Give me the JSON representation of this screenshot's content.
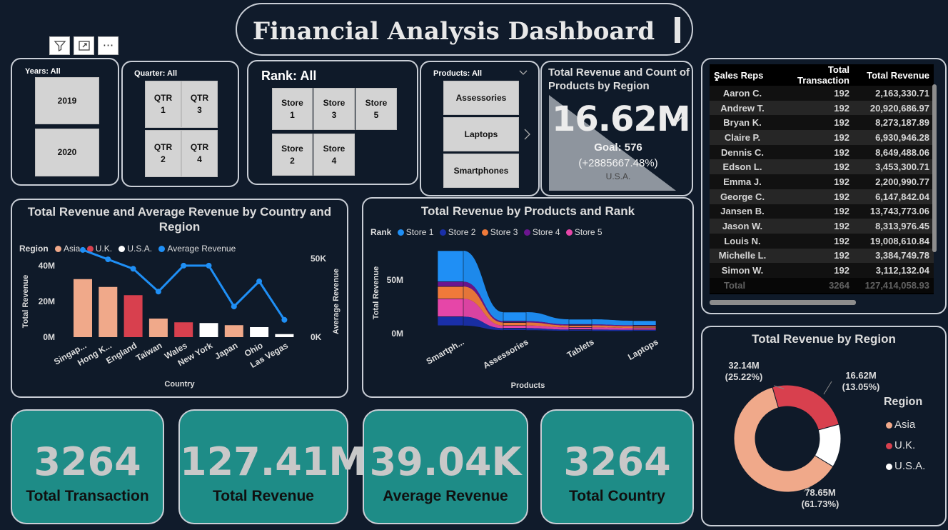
{
  "header": {
    "title": "Financial Analysis Dashboard"
  },
  "toolbar": {
    "filter_icon": "filter-icon",
    "focus_icon": "focus-mode-icon",
    "more_icon": "more-options-icon",
    "more_glyph": "···"
  },
  "years": {
    "title": "Years: All",
    "options": [
      "2019",
      "2020"
    ]
  },
  "quarter": {
    "title": "Quarter: All",
    "options": [
      "QTR 1",
      "QTR 3",
      "QTR 2",
      "QTR 4"
    ]
  },
  "rank": {
    "title": "Rank: All",
    "options": [
      "Store 1",
      "Store 3",
      "Store 5",
      "Store 2",
      "Store 4"
    ]
  },
  "products": {
    "title": "Products: All",
    "options": [
      "Assessories",
      "Laptops",
      "Smartphones"
    ]
  },
  "kpi_card": {
    "title": "Total Revenue and Count of Products by Region",
    "value": "16.62M",
    "goal": "Goal: 576",
    "delta": "(+2885667.48%)",
    "region": "U.S.A."
  },
  "reps_table": {
    "columns": [
      "Sales Reps",
      "Total Transaction",
      "Total Revenue"
    ],
    "rows": [
      [
        "Aaron C.",
        "192",
        "2,163,330.71"
      ],
      [
        "Andrew T.",
        "192",
        "20,920,686.97"
      ],
      [
        "Bryan K.",
        "192",
        "8,273,187.89"
      ],
      [
        "Claire P.",
        "192",
        "6,930,946.28"
      ],
      [
        "Dennis C.",
        "192",
        "8,649,488.06"
      ],
      [
        "Edson L.",
        "192",
        "3,453,300.71"
      ],
      [
        "Emma J.",
        "192",
        "2,200,990.77"
      ],
      [
        "George C.",
        "192",
        "6,147,842.04"
      ],
      [
        "Jansen B.",
        "192",
        "13,743,773.06"
      ],
      [
        "Jason W.",
        "192",
        "8,313,976.45"
      ],
      [
        "Louis N.",
        "192",
        "19,008,610.84"
      ],
      [
        "Michelle L.",
        "192",
        "3,384,749.78"
      ],
      [
        "Simon W.",
        "192",
        "3,112,132.04"
      ]
    ],
    "total": [
      "Total",
      "3264",
      "127,414,058.93"
    ]
  },
  "kpis": [
    {
      "value": "3264",
      "label": "Total Transaction"
    },
    {
      "value": "127.41M",
      "label": "Total Revenue"
    },
    {
      "value": "39.04K",
      "label": "Average Revenue"
    },
    {
      "value": "3264",
      "label": "Total Country"
    }
  ],
  "colors": {
    "asia": "#f0a98a",
    "uk": "#d8404e",
    "usa": "#ffffff",
    "avg": "#1f8ff5",
    "store1": "#1f8ff5",
    "store2": "#1a2fa8",
    "store3": "#f07a3a",
    "store4": "#6c1590",
    "store5": "#e646a8",
    "kpi_teal": "#1e8c87"
  },
  "chart_data": [
    {
      "type": "bar",
      "title": "Total Revenue and Average Revenue by Country and Region",
      "legend_title": "Region",
      "legend": [
        "Asia",
        "U.K.",
        "U.S.A.",
        "Average Revenue"
      ],
      "xlabel": "Country",
      "ylabel": "Total Revenue",
      "y2label": "Average Revenue",
      "categories": [
        "Singap...",
        "Hong K...",
        "England",
        "Taiwan",
        "Wales",
        "New York",
        "Japan",
        "Ohio",
        "Las Vegas"
      ],
      "regions": [
        "Asia",
        "Asia",
        "U.K.",
        "Asia",
        "U.K.",
        "U.S.A.",
        "Asia",
        "U.S.A.",
        "U.S.A."
      ],
      "values": [
        32.5,
        28.1,
        23.5,
        10.4,
        8.3,
        7.9,
        6.7,
        5.6,
        1.7
      ],
      "avg_revenue": [
        55.5,
        49.5,
        43.5,
        29.0,
        45.5,
        45.5,
        19.5,
        35.5,
        11.0
      ],
      "yticks": [
        "0M",
        "20M",
        "40M"
      ],
      "y2ticks": [
        "0K",
        "50K"
      ],
      "ylim": [
        0,
        40
      ],
      "y2lim": [
        0,
        60
      ]
    },
    {
      "type": "area",
      "title": "Total Revenue by Products and Rank",
      "legend_title": "Rank",
      "series_names": [
        "Store 1",
        "Store 2",
        "Store 3",
        "Store 4",
        "Store 5"
      ],
      "xlabel": "Products",
      "ylabel": "Total Revenue",
      "categories": [
        "Smartph...",
        "Assessories",
        "Tablets",
        "Laptops"
      ],
      "yticks": [
        "0M",
        "50M"
      ],
      "ylim": [
        0,
        80
      ]
    },
    {
      "type": "pie",
      "title": "Total Revenue by Region",
      "legend_title": "Region",
      "slices": [
        {
          "name": "Asia",
          "value": 78.65,
          "label": "78.65M",
          "pct": "(61.73%)"
        },
        {
          "name": "U.K.",
          "value": 32.14,
          "label": "32.14M",
          "pct": "(25.22%)"
        },
        {
          "name": "U.S.A.",
          "value": 16.62,
          "label": "16.62M",
          "pct": "(13.05%)"
        }
      ]
    }
  ]
}
